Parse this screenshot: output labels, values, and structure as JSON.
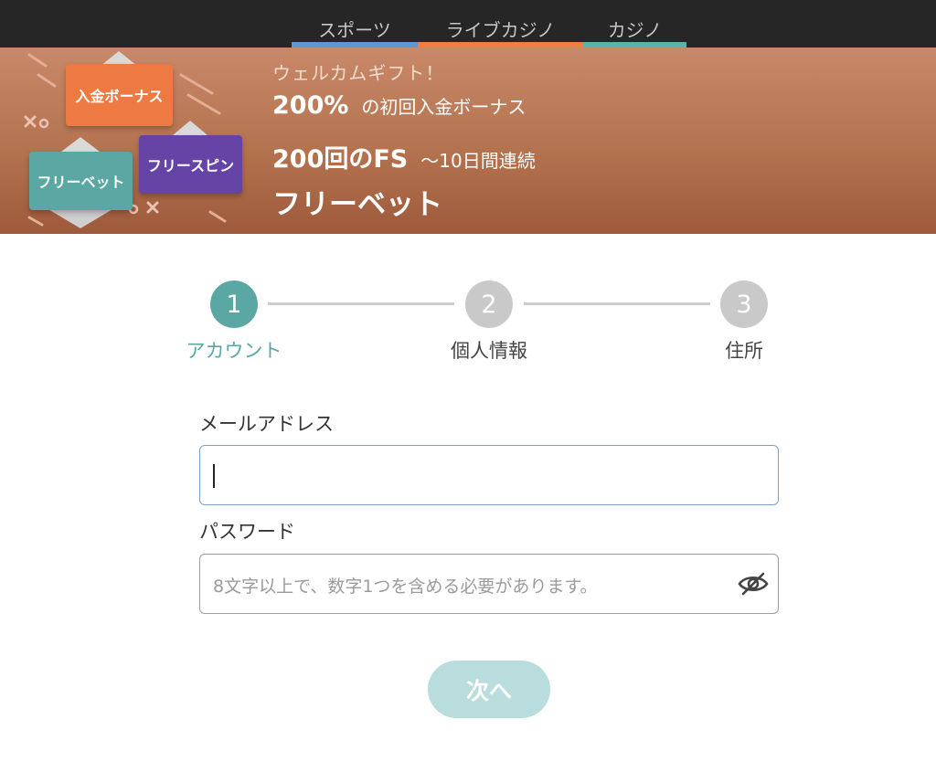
{
  "colors": {
    "tab_sports_bar": "#5f97d3",
    "tab_live_bar": "#f27c44",
    "tab_casino_bar": "#5fb1ad",
    "step_active": "#5aa7a4",
    "step_inactive": "#c9c9c9",
    "step_label_active": "#5aa7a4",
    "step_label_inactive": "#444444"
  },
  "nav": {
    "tabs": [
      {
        "label": "スポーツ"
      },
      {
        "label": "ライブカジノ"
      },
      {
        "label": "カジノ"
      }
    ]
  },
  "banner": {
    "cards": {
      "deposit_bonus": "入金ボーナス",
      "free_spin": "フリースピン",
      "free_bet": "フリーベット"
    },
    "welcome": "ウェルカムギフト！",
    "line1_big": "200%",
    "line1_small": "の初回入金ボーナス",
    "line2_big": "200回のFS",
    "line2_small": "〜10日間連続",
    "line3": "フリーベット"
  },
  "stepper": {
    "steps": [
      {
        "number": "1",
        "label": "アカウント",
        "active": true
      },
      {
        "number": "2",
        "label": "個人情報",
        "active": false
      },
      {
        "number": "3",
        "label": "住所",
        "active": false
      }
    ]
  },
  "form": {
    "email_label": "メールアドレス",
    "email_value": "",
    "password_label": "パスワード",
    "password_placeholder": "8文字以上で、数字1つを含める必要があります。",
    "password_visibility_icon": "eye-slash-icon"
  },
  "actions": {
    "next_label": "次へ"
  }
}
